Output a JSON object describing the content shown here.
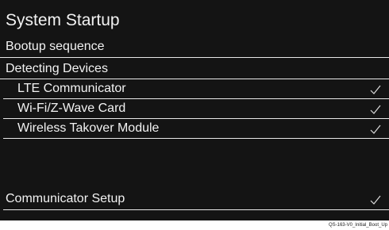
{
  "screen": {
    "title": "System Startup",
    "subtitle": "Bootup sequence",
    "section_label": "Detecting Devices"
  },
  "devices": [
    {
      "label": "LTE Communicator",
      "status_icon": "checkmark-icon",
      "detected": true
    },
    {
      "label": "Wi-Fi/Z-Wave Card",
      "status_icon": "checkmark-icon",
      "detected": true
    },
    {
      "label": "Wireless Takover Module",
      "status_icon": "checkmark-icon",
      "detected": true
    }
  ],
  "setup": {
    "label": "Communicator Setup",
    "status_icon": "checkmark-icon",
    "complete": true
  },
  "caption": "QS-163-V0_Initial_Boot_Up",
  "colors": {
    "background": "#141414",
    "text": "#f2f2f2",
    "divider": "#e8e8e8",
    "check": "#dcdcdc"
  }
}
